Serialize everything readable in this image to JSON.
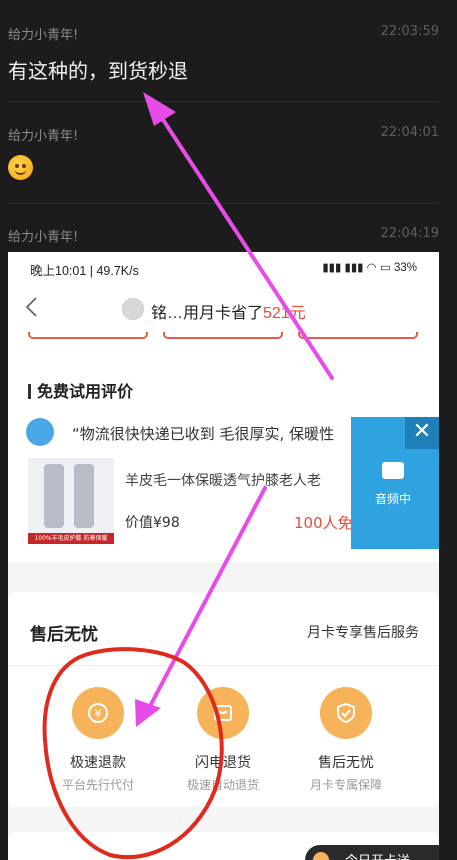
{
  "messages": [
    {
      "sender": "给力小青年!",
      "time": "22:03:59",
      "text": "有这种的，到货秒退"
    },
    {
      "sender": "给力小青年!",
      "time": "22:04:01"
    },
    {
      "sender": "给力小青年!",
      "time": "22:04:19"
    }
  ],
  "screenshot": {
    "status": {
      "left": "晚上10:01 | 49.7K/s",
      "right": "33%"
    },
    "nav": {
      "title_prefix": "铭…用月卡省了",
      "title_amount": "521元"
    },
    "review": {
      "section_title": "免费试用评价",
      "quote": "“物流很快快递已收到 毛很厚实, 保暖性",
      "product_name": "羊皮毛一体保暖透气护膝老人老",
      "product_price": "价值¥98",
      "product_free": "100人免",
      "product_img_strip": "100%羊毛皮护膝 防寒保暖"
    },
    "float": {
      "close": "✕",
      "label": "音频中"
    },
    "after_sales": {
      "title": "售后无忧",
      "link": "月卡专享售后服务",
      "features": [
        {
          "label": "极速退款",
          "sub": "平台先行代付",
          "icon": "yen-refresh-icon"
        },
        {
          "label": "闪电退货",
          "sub": "极速自动退货",
          "icon": "bag-icon"
        },
        {
          "label": "售后无忧",
          "sub": "月卡专属保障",
          "icon": "shield-check-icon"
        }
      ]
    },
    "promo": "今日开卡送"
  },
  "colors": {
    "arrow": "#e84ce8",
    "circle": "#e02a1e",
    "accent_red": "#e84a3b",
    "float_blue": "#2fa3e0"
  }
}
